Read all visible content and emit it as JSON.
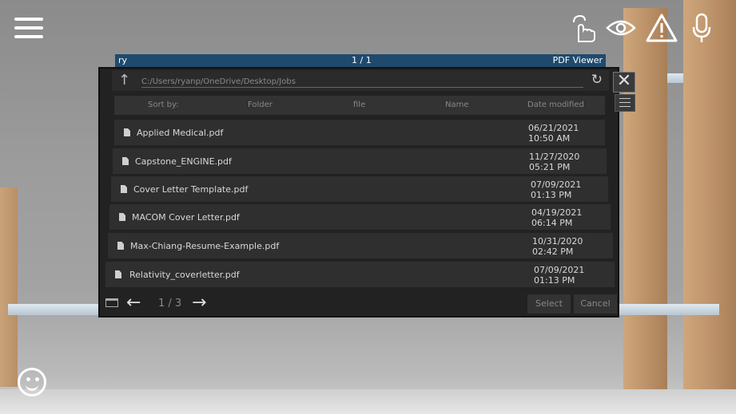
{
  "window": {
    "title_left": "ry",
    "title_page": "1 / 1",
    "title_app": "PDF Viewer"
  },
  "path": "C:/Users/ryanp/OneDrive/Desktop/Jobs",
  "sort": {
    "label": "Sort by:",
    "folder": "Folder",
    "file": "file",
    "name": "Name",
    "date": "Date modified"
  },
  "files": [
    {
      "name": "Applied Medical.pdf",
      "date": "06/21/2021 10:50 AM"
    },
    {
      "name": "Capstone_ENGINE.pdf",
      "date": "11/27/2020 05:21 PM"
    },
    {
      "name": "Cover Letter Template.pdf",
      "date": "07/09/2021 01:13 PM"
    },
    {
      "name": "MACOM Cover Letter.pdf",
      "date": "04/19/2021 06:14 PM"
    },
    {
      "name": "Max-Chiang-Resume-Example.pdf",
      "date": "10/31/2020 02:42 PM"
    },
    {
      "name": "Relativity_coverletter.pdf",
      "date": "07/09/2021 01:13 PM"
    }
  ],
  "footer": {
    "page": "1 / 3",
    "select": "Select",
    "cancel": "Cancel"
  },
  "icons": {
    "menu": "hamburger-icon",
    "hand": "hand-pointer-icon",
    "eye": "eye-icon",
    "warning": "warning-icon",
    "mic": "microphone-icon",
    "emoji": "smiley-icon"
  }
}
